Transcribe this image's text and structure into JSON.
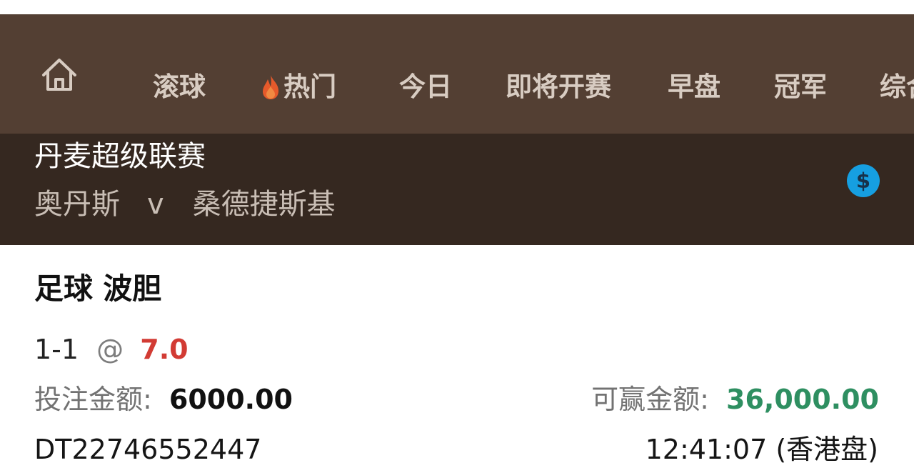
{
  "navigation": {
    "home_icon": "home-icon",
    "items": [
      {
        "label": "滚球"
      },
      {
        "label": "热门",
        "icon": "fire-icon",
        "icon_color": "#e65a2b"
      },
      {
        "label": "今日"
      },
      {
        "label": "即将开赛"
      },
      {
        "label": "早盘"
      },
      {
        "label": "冠军"
      },
      {
        "label": "综合"
      }
    ]
  },
  "match": {
    "league": "丹麦超级联赛",
    "home_team": "奥丹斯",
    "versus": "v",
    "away_team": "桑德捷斯基",
    "currency_icon": "dollar-icon",
    "currency_symbol": "$",
    "currency_color": "#169fe1"
  },
  "bet": {
    "title": "足球 波胆",
    "selection": "1-1",
    "at_symbol": "@",
    "odds": "7.0",
    "stake_label": "投注金额:",
    "stake_amount": "6000.00",
    "potential_win_label": "可赢金额:",
    "potential_win_amount": "36,000.00",
    "ticket_id": "DT22746552447",
    "time": "12:41:07 (香港盘)"
  },
  "colors": {
    "nav_background": "#533f33",
    "match_background": "#352820",
    "nav_text": "#d8ccc2",
    "odds_red": "#d23b34",
    "win_green": "#2e8f61"
  }
}
